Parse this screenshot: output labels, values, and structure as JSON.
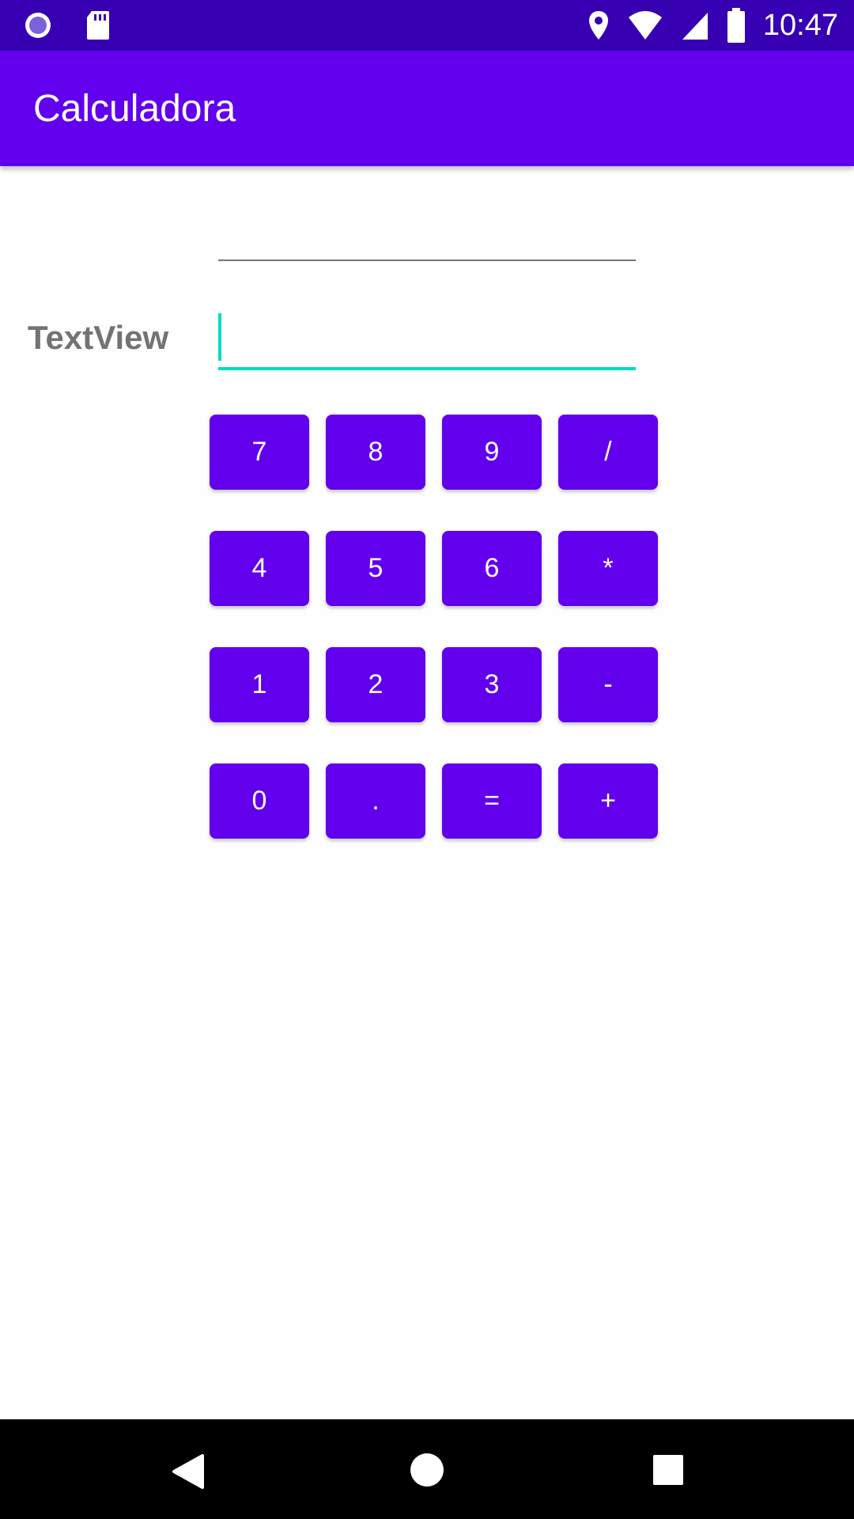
{
  "status_bar": {
    "time": "10:47",
    "left_icons": [
      "circle-indicator-icon",
      "sd-card-icon"
    ],
    "right_icons": [
      "location-icon",
      "wifi-icon",
      "signal-icon",
      "battery-icon"
    ],
    "background": "#3700b3"
  },
  "app_bar": {
    "title": "Calculadora",
    "background": "#6200ee"
  },
  "main": {
    "textview_label": "TextView",
    "input_top_value": "",
    "input_bottom_value": "",
    "accent": "#03dac5"
  },
  "keypad": {
    "button_color": "#6200ee",
    "rows": [
      [
        "7",
        "8",
        "9",
        "/"
      ],
      [
        "4",
        "5",
        "6",
        "*"
      ],
      [
        "1",
        "2",
        "3",
        "-"
      ],
      [
        "0",
        ".",
        "=",
        "+"
      ]
    ]
  },
  "nav_bar": {
    "icons": [
      "back-icon",
      "home-icon",
      "recents-icon"
    ]
  }
}
